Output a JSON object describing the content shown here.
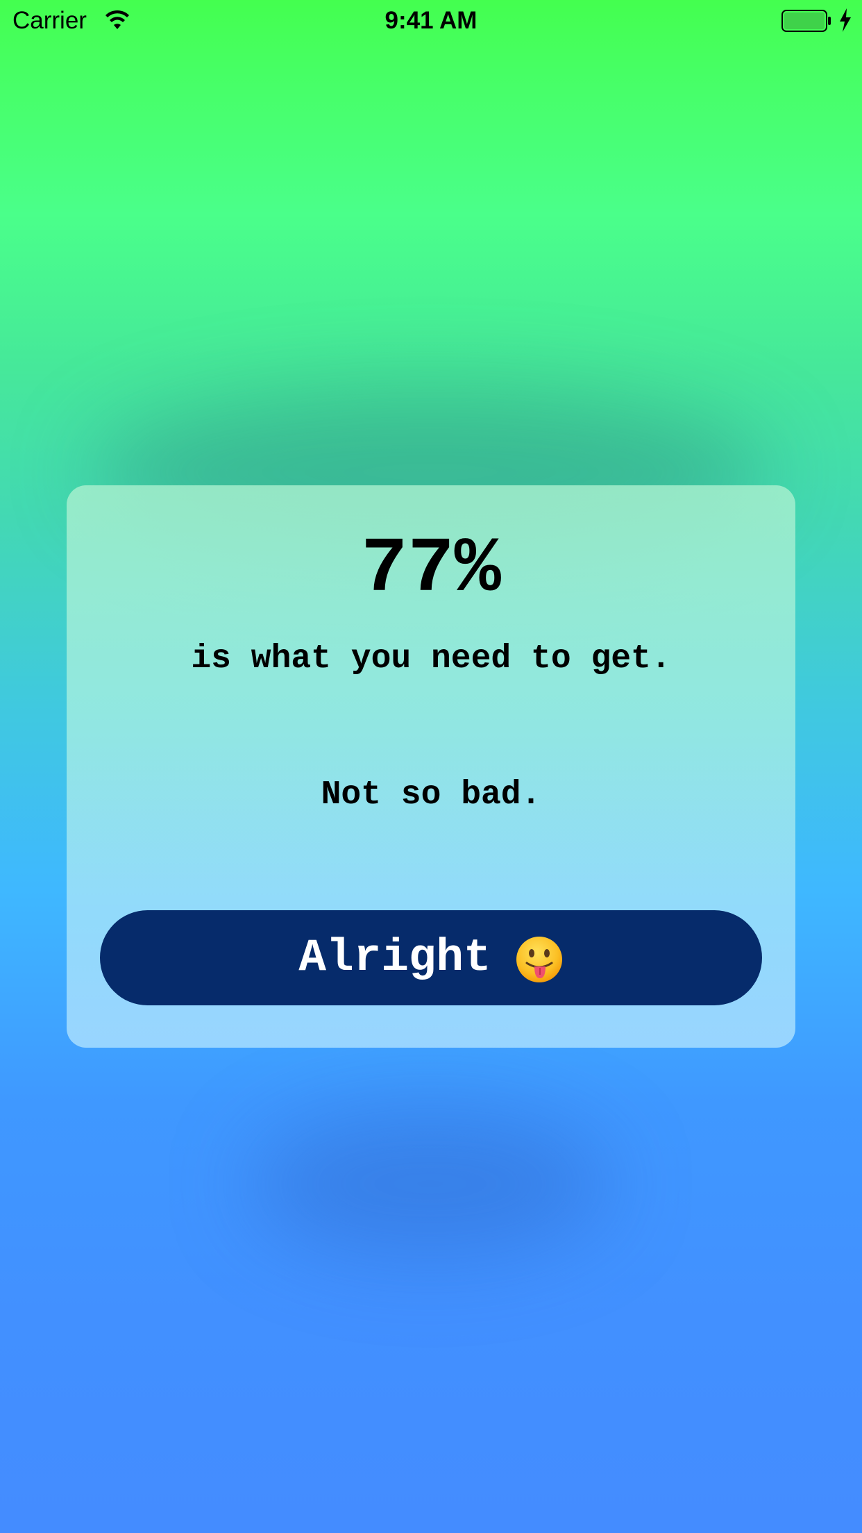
{
  "status_bar": {
    "carrier": "Carrier",
    "time": "9:41 AM",
    "wifi_icon": "wifi-icon",
    "battery_icon": "battery-icon",
    "charging_icon": "bolt-icon"
  },
  "card": {
    "percent": "77%",
    "need_text": "is what you need to get.",
    "comment": "Not so bad.",
    "button": {
      "label": "Alright",
      "emoji_icon": "tongue-out-face-icon"
    }
  },
  "colors": {
    "button_bg": "#062b6b",
    "button_text": "#ffffff",
    "gradient_top": "#44ff4f",
    "gradient_bottom": "#448cff"
  }
}
